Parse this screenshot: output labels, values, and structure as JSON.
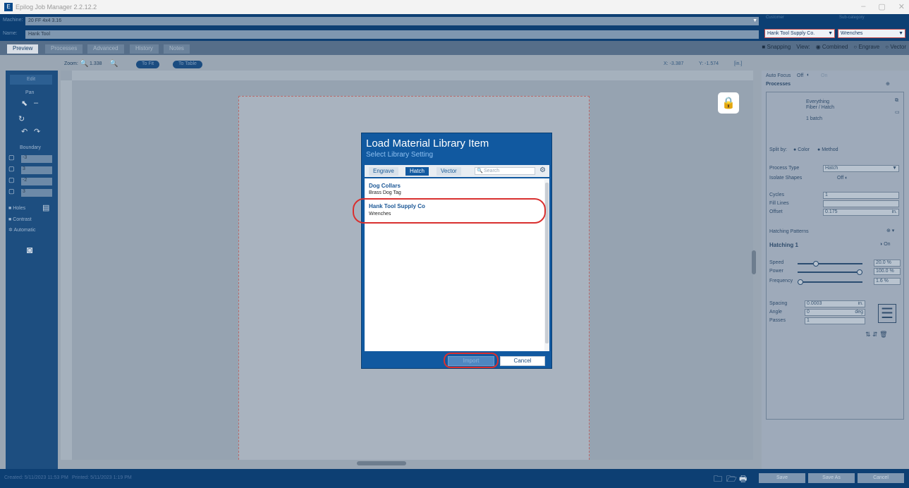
{
  "window": {
    "title": "Epilog Job Manager 2.2.12.2",
    "min": "–",
    "max": "▢",
    "close": "✕"
  },
  "header": {
    "machine_label": "Machine:",
    "machine_value": "20 FF 4x4 3.16",
    "name_label": "Name:",
    "name_value": "Hank Tool",
    "customer_label": "Customer",
    "customer_value": "Hank Tool Supply Co.",
    "subcategory_label": "Sub-category",
    "subcategory_value": "Wrenches"
  },
  "tabs": [
    "Preview",
    "Processes",
    "Advanced",
    "History",
    "Notes"
  ],
  "view_options": {
    "snapping": "Snapping",
    "view_label": "View:",
    "combined": "Combined",
    "engrave": "Engrave",
    "vector": "Vector"
  },
  "toolbar": {
    "zoom_label": "Zoom:",
    "zoom_value": "1.338",
    "to_fit": "To Fit",
    "to_table": "To Table",
    "x_coord": "X: -3.387",
    "y_coord": "Y: -1.574",
    "unit": "[in.]"
  },
  "left_panel": {
    "edit": "Edit",
    "pan": "Pan",
    "boundary": "Boundary",
    "b1": "-3",
    "b2": "3",
    "b3": "-2",
    "b4": "3",
    "holes": "Holes",
    "contrast": "Contrast",
    "automatic": "Automatic"
  },
  "right_panel": {
    "auto_focus": "Auto Focus",
    "af_off": "Off",
    "af_on": "On",
    "processes": "Processes",
    "proc_name": "Everything",
    "proc_sub": "Fiber / Hatch",
    "proc_count": "1 batch",
    "split_by": "Split by:",
    "split_color": "Color",
    "split_method": "Method",
    "process_type": "Process Type",
    "process_type_value": "Hatch",
    "isolate_shapes": "Isolate Shapes",
    "off": "Off",
    "cycles": "Cycles",
    "cycles_value": "1",
    "fill_lines": "Fill Lines",
    "offset": "Offset",
    "offset_value": "0.175",
    "offset_unit": "in.",
    "hatching_patterns": "Hatching Patterns",
    "hatching_1": "Hatching 1",
    "on": "On",
    "speed": "Speed",
    "speed_value": "20.0 %",
    "power": "Power",
    "power_value": "100.0 %",
    "frequency": "Frequency",
    "frequency_value": "1.6 %",
    "spacing": "Spacing",
    "spacing_value": "0.0003",
    "spacing_unit": "in.",
    "angle": "Angle",
    "angle_value": "0",
    "angle_unit": "deg",
    "passes": "Passes",
    "passes_value": "1"
  },
  "status": {
    "created": "Created: 5/11/2023 11:53 PM",
    "printed": "Printed: 5/11/2023 1:19 PM",
    "save": "Save",
    "save_as": "Save As",
    "cancel": "Cancel"
  },
  "dialog": {
    "title": "Load Material Library Item",
    "subtitle": "Select Library Setting",
    "tabs": [
      "Engrave",
      "Hatch",
      "Vector"
    ],
    "search_placeholder": "Search",
    "groups": [
      {
        "name": "Dog Collars",
        "items": [
          "Brass Dog Tag"
        ]
      },
      {
        "name": "Hank Tool Supply Co",
        "items": [
          "Wrenches"
        ]
      }
    ],
    "import": "Import",
    "cancel": "Cancel"
  }
}
